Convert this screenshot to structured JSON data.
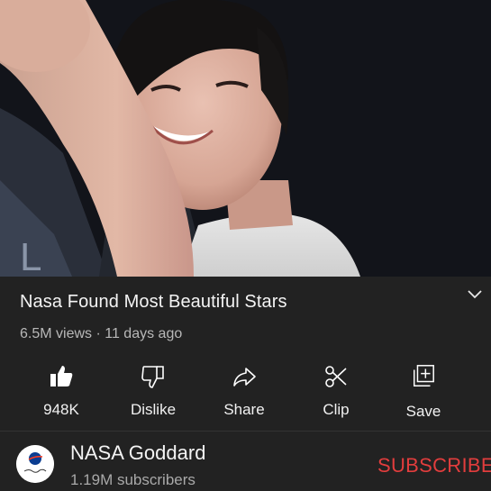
{
  "video": {
    "thumbnail_description": "video-frame",
    "accent": "#e23d3d"
  },
  "title": "Nasa Found Most Beautiful Stars",
  "meta": "6.5M views · 11 days ago",
  "actions": [
    {
      "label": "948K",
      "icon": "thumbs-up-icon"
    },
    {
      "label": "Dislike",
      "icon": "thumbs-down-icon"
    },
    {
      "label": "Share",
      "icon": "share-icon"
    },
    {
      "label": "Clip",
      "icon": "scissors-icon"
    },
    {
      "label": "Save",
      "icon": "add-to-playlist-icon"
    }
  ],
  "channel": {
    "name": "NASA Goddard",
    "subscribers": "1.19M subscribers",
    "subscribe_label": "SUBSCRIBE"
  },
  "colors": {
    "background": "#222222",
    "subscribe": "#e23d3d",
    "secondary_text": "#b8b8b8"
  }
}
